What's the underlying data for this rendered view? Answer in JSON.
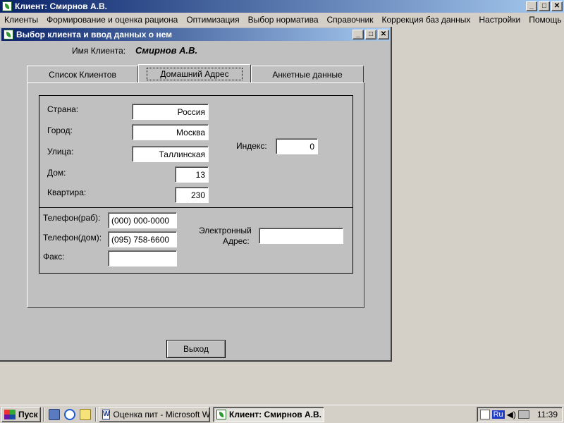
{
  "main_window": {
    "title": "Клиент: Смирнов А.В."
  },
  "menu": [
    {
      "label": "Клиенты",
      "name": "menu-clients"
    },
    {
      "label": "Формирование и оценка рациона",
      "name": "menu-ration"
    },
    {
      "label": "Оптимизация",
      "name": "menu-optimization"
    },
    {
      "label": "Выбор норматива",
      "name": "menu-norm"
    },
    {
      "label": "Справочник",
      "name": "menu-reference"
    },
    {
      "label": "Коррекция баз данных",
      "name": "menu-db-correction"
    },
    {
      "label": "Настройки",
      "name": "menu-settings"
    },
    {
      "label": "Помощь",
      "name": "menu-help"
    }
  ],
  "child_window": {
    "title": "Выбор клиента и ввод данных о нем",
    "client_label": "Имя Клиента:",
    "client_name": "Смирнов А.В."
  },
  "tabs": {
    "clients_list": "Список Клиентов",
    "home_address": "Домашний Адрес",
    "profile": "Анкетные данные"
  },
  "address": {
    "country_label": "Страна:",
    "country": "Россия",
    "city_label": "Город:",
    "city": "Москва",
    "street_label": "Улица:",
    "street": "Таллинская",
    "house_label": "Дом:",
    "house": "13",
    "apartment_label": "Квартира:",
    "apartment": "230",
    "index_label": "Индекс:",
    "index": "0"
  },
  "contacts": {
    "phone_work_label": "Телефон(раб):",
    "phone_work": "(000) 000-0000",
    "phone_home_label": "Телефон(дом):",
    "phone_home": "(095) 758-6600",
    "fax_label": "Факс:",
    "fax": "",
    "email_label_1": "Электронный",
    "email_label_2": "Адрес:",
    "email": ""
  },
  "exit_button": "Выход",
  "taskbar": {
    "start": "Пуск",
    "task_word": "Оценка пит - Microsoft W...",
    "task_client": "Клиент: Смирнов А.В.",
    "lang": "Ru",
    "clock": "11:39"
  },
  "colors": {
    "title_active": "#0a246a",
    "title_gradient_end": "#a6caf0",
    "face": "#d4d0c8"
  }
}
